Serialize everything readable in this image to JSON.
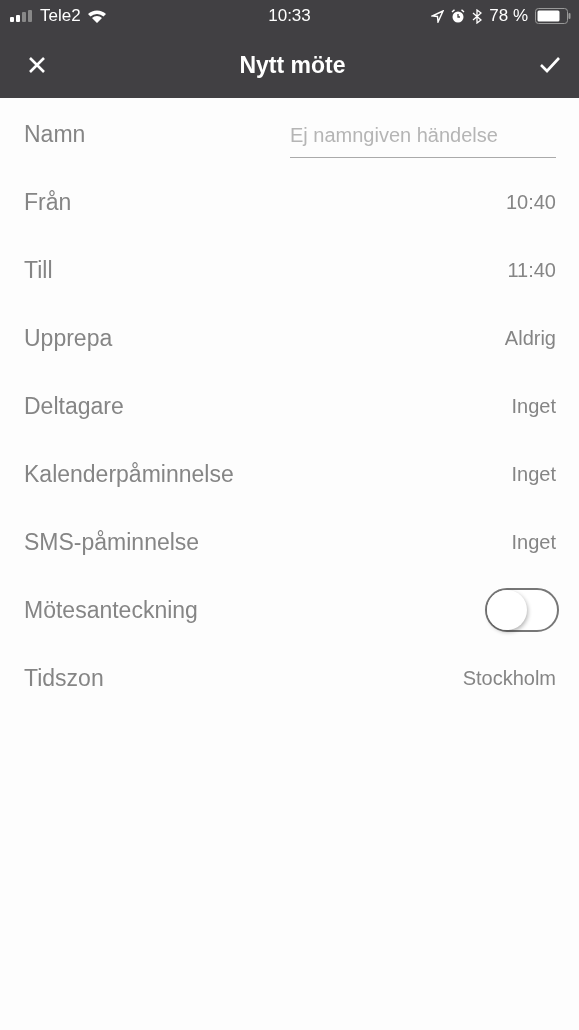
{
  "status_bar": {
    "carrier": "Tele2",
    "time": "10:33",
    "battery": "78 %"
  },
  "nav": {
    "title": "Nytt möte"
  },
  "rows": [
    {
      "kind": "field",
      "label": "Namn",
      "placeholder": "Ej namngiven händelse"
    },
    {
      "kind": "value",
      "label": "Från",
      "value": "10:40"
    },
    {
      "kind": "value",
      "label": "Till",
      "value": "11:40"
    },
    {
      "kind": "value",
      "label": "Upprepa",
      "value": "Aldrig"
    },
    {
      "kind": "value",
      "label": "Deltagare",
      "value": "Inget"
    },
    {
      "kind": "value",
      "label": "Kalenderpåminnelse",
      "value": "Inget"
    },
    {
      "kind": "value",
      "label": "SMS-påminnelse",
      "value": "Inget"
    },
    {
      "kind": "toggle",
      "label": "Mötesanteckning",
      "on": false
    },
    {
      "kind": "value",
      "label": "Tidszon",
      "value": "Stockholm"
    }
  ]
}
